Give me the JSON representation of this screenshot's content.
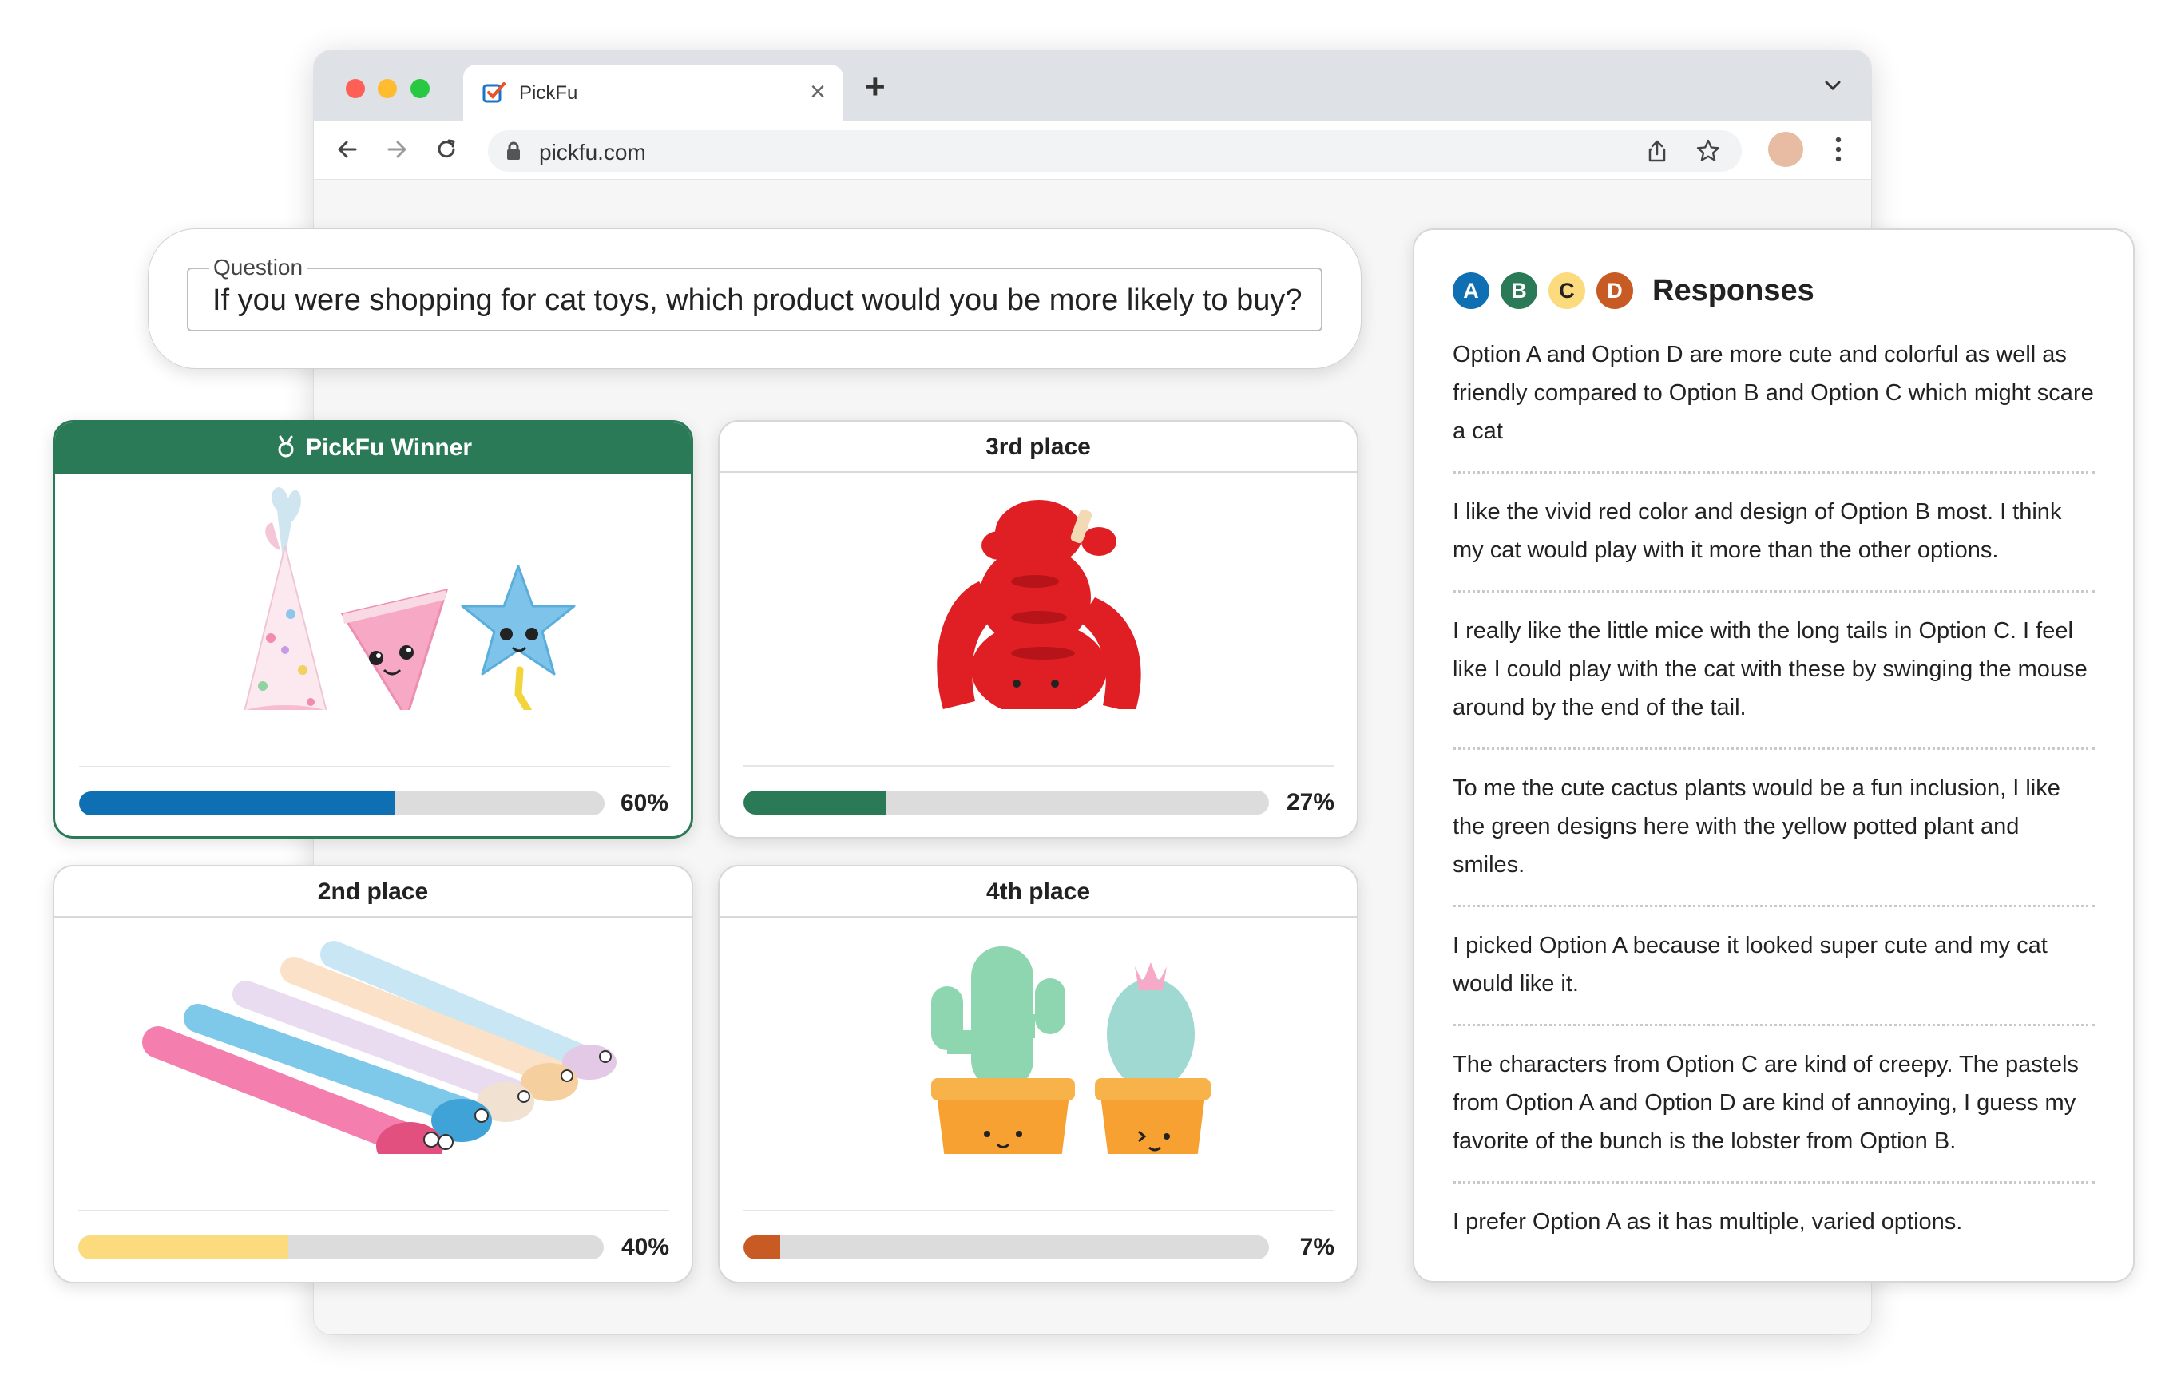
{
  "browser": {
    "tab_title": "PickFu",
    "url": "pickfu.com",
    "new_tab_glyph": "+",
    "close_glyph": "×"
  },
  "question": {
    "label": "Question",
    "text": "If you were shopping for cat toys, which product would you be more likely to buy?"
  },
  "options": [
    {
      "header": "PickFu Winner",
      "percent": 60,
      "percent_label": "60%",
      "bar_color": "#0e6fb3",
      "winner": true
    },
    {
      "header": "3rd place",
      "percent": 27,
      "percent_label": "27%",
      "bar_color": "#2a7a57",
      "winner": false
    },
    {
      "header": "2nd place",
      "percent": 40,
      "percent_label": "40%",
      "bar_color": "#fbdb7d",
      "winner": false
    },
    {
      "header": "4th place",
      "percent": 7,
      "percent_label": "7%",
      "bar_color": "#c85a24",
      "winner": false
    }
  ],
  "responses": {
    "title": "Responses",
    "badges": [
      {
        "letter": "A",
        "bg": "#0e6fb3",
        "fg": "#ffffff"
      },
      {
        "letter": "B",
        "bg": "#2a7a57",
        "fg": "#ffffff"
      },
      {
        "letter": "C",
        "bg": "#fbdb7d",
        "fg": "#222222"
      },
      {
        "letter": "D",
        "bg": "#c85a24",
        "fg": "#ffffff"
      }
    ],
    "items": [
      "Option A and Option D are more cute and colorful as well as friendly compared to Option B and Option C which might scare a cat",
      "I like the vivid red color and design of Option B most. I think my cat would play with it more than the other options.",
      "I  really like the little mice with the long tails in Option C. I feel like I could play with the cat with these by swinging the mouse around  by the end of the tail.",
      "To me the cute cactus plants would be a fun inclusion, I like the green designs here with the yellow potted plant and smiles.",
      "I picked Option A because it looked super cute and my cat would like it.",
      "The  characters from Option C are kind of creepy. The pastels from Option A and Option D are kind  of annoying, I guess my favorite of the bunch is the lobster from Option B.",
      "I prefer Option A as it has multiple, varied options."
    ]
  }
}
